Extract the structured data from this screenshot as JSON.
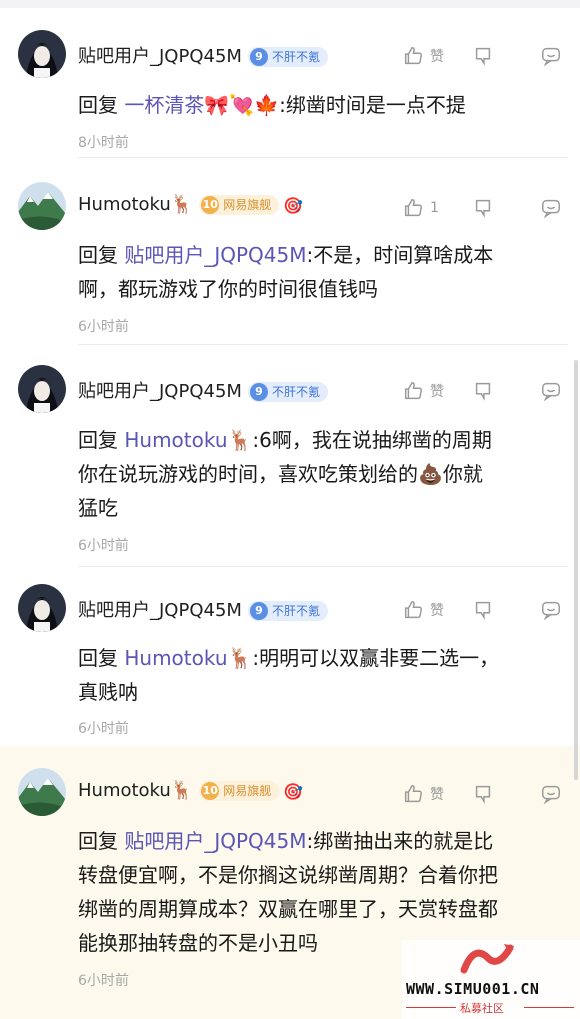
{
  "comments": [
    {
      "user": "贴吧用户_JQPQ45M",
      "level": "9",
      "level_title": "不肝不氪",
      "level_style": "blue",
      "extra_emoji": "",
      "likes": "赞",
      "reply_prefix": "回复",
      "reply_to": "一杯清茶🎀💘🍁",
      "lines": [
        ":绑凿时间是一点不提"
      ],
      "time": "8小时前"
    },
    {
      "user": "Humotoku🦌",
      "level": "10",
      "level_title": "网易旗舰",
      "level_style": "gold",
      "extra_emoji": "🎯",
      "likes": "1",
      "reply_prefix": "回复",
      "reply_to": "贴吧用户_JQPQ45M",
      "lines": [
        ":不是，时间算啥成本",
        "啊，都玩游戏了你的时间很值钱吗"
      ],
      "time": "6小时前"
    },
    {
      "user": "贴吧用户_JQPQ45M",
      "level": "9",
      "level_title": "不肝不氪",
      "level_style": "blue",
      "extra_emoji": "",
      "likes": "赞",
      "reply_prefix": "回复",
      "reply_to": "Humotoku🦌",
      "lines": [
        ":6啊，我在说抽绑凿的周期",
        "你在说玩游戏的时间，喜欢吃策划给的💩你就",
        "猛吃"
      ],
      "time": "6小时前"
    },
    {
      "user": "贴吧用户_JQPQ45M",
      "level": "9",
      "level_title": "不肝不氪",
      "level_style": "blue",
      "extra_emoji": "",
      "likes": "赞",
      "reply_prefix": "回复",
      "reply_to": "Humotoku🦌",
      "lines": [
        ":明明可以双赢非要二选一，",
        "真贱呐"
      ],
      "time": "6小时前"
    },
    {
      "user": "Humotoku🦌",
      "level": "10",
      "level_title": "网易旗舰",
      "level_style": "gold",
      "extra_emoji": "🎯",
      "likes": "赞",
      "reply_prefix": "回复",
      "reply_to": "贴吧用户_JQPQ45M",
      "lines": [
        ":绑凿抽出来的就是比",
        "转盘便宜啊，不是你搁这说绑凿周期？合着你把",
        "绑凿的周期算成本？双赢在哪里了，天赏转盘都",
        "能换那抽转盘的不是小丑吗"
      ],
      "time": "6小时前"
    }
  ],
  "watermark": {
    "site": "WWW.SIMU001.CN",
    "subtitle": "私募社区"
  },
  "colors": {
    "mention": "#5b56b5",
    "highlight_bg": "#fdf9ec",
    "muted": "#a8a8a8"
  }
}
